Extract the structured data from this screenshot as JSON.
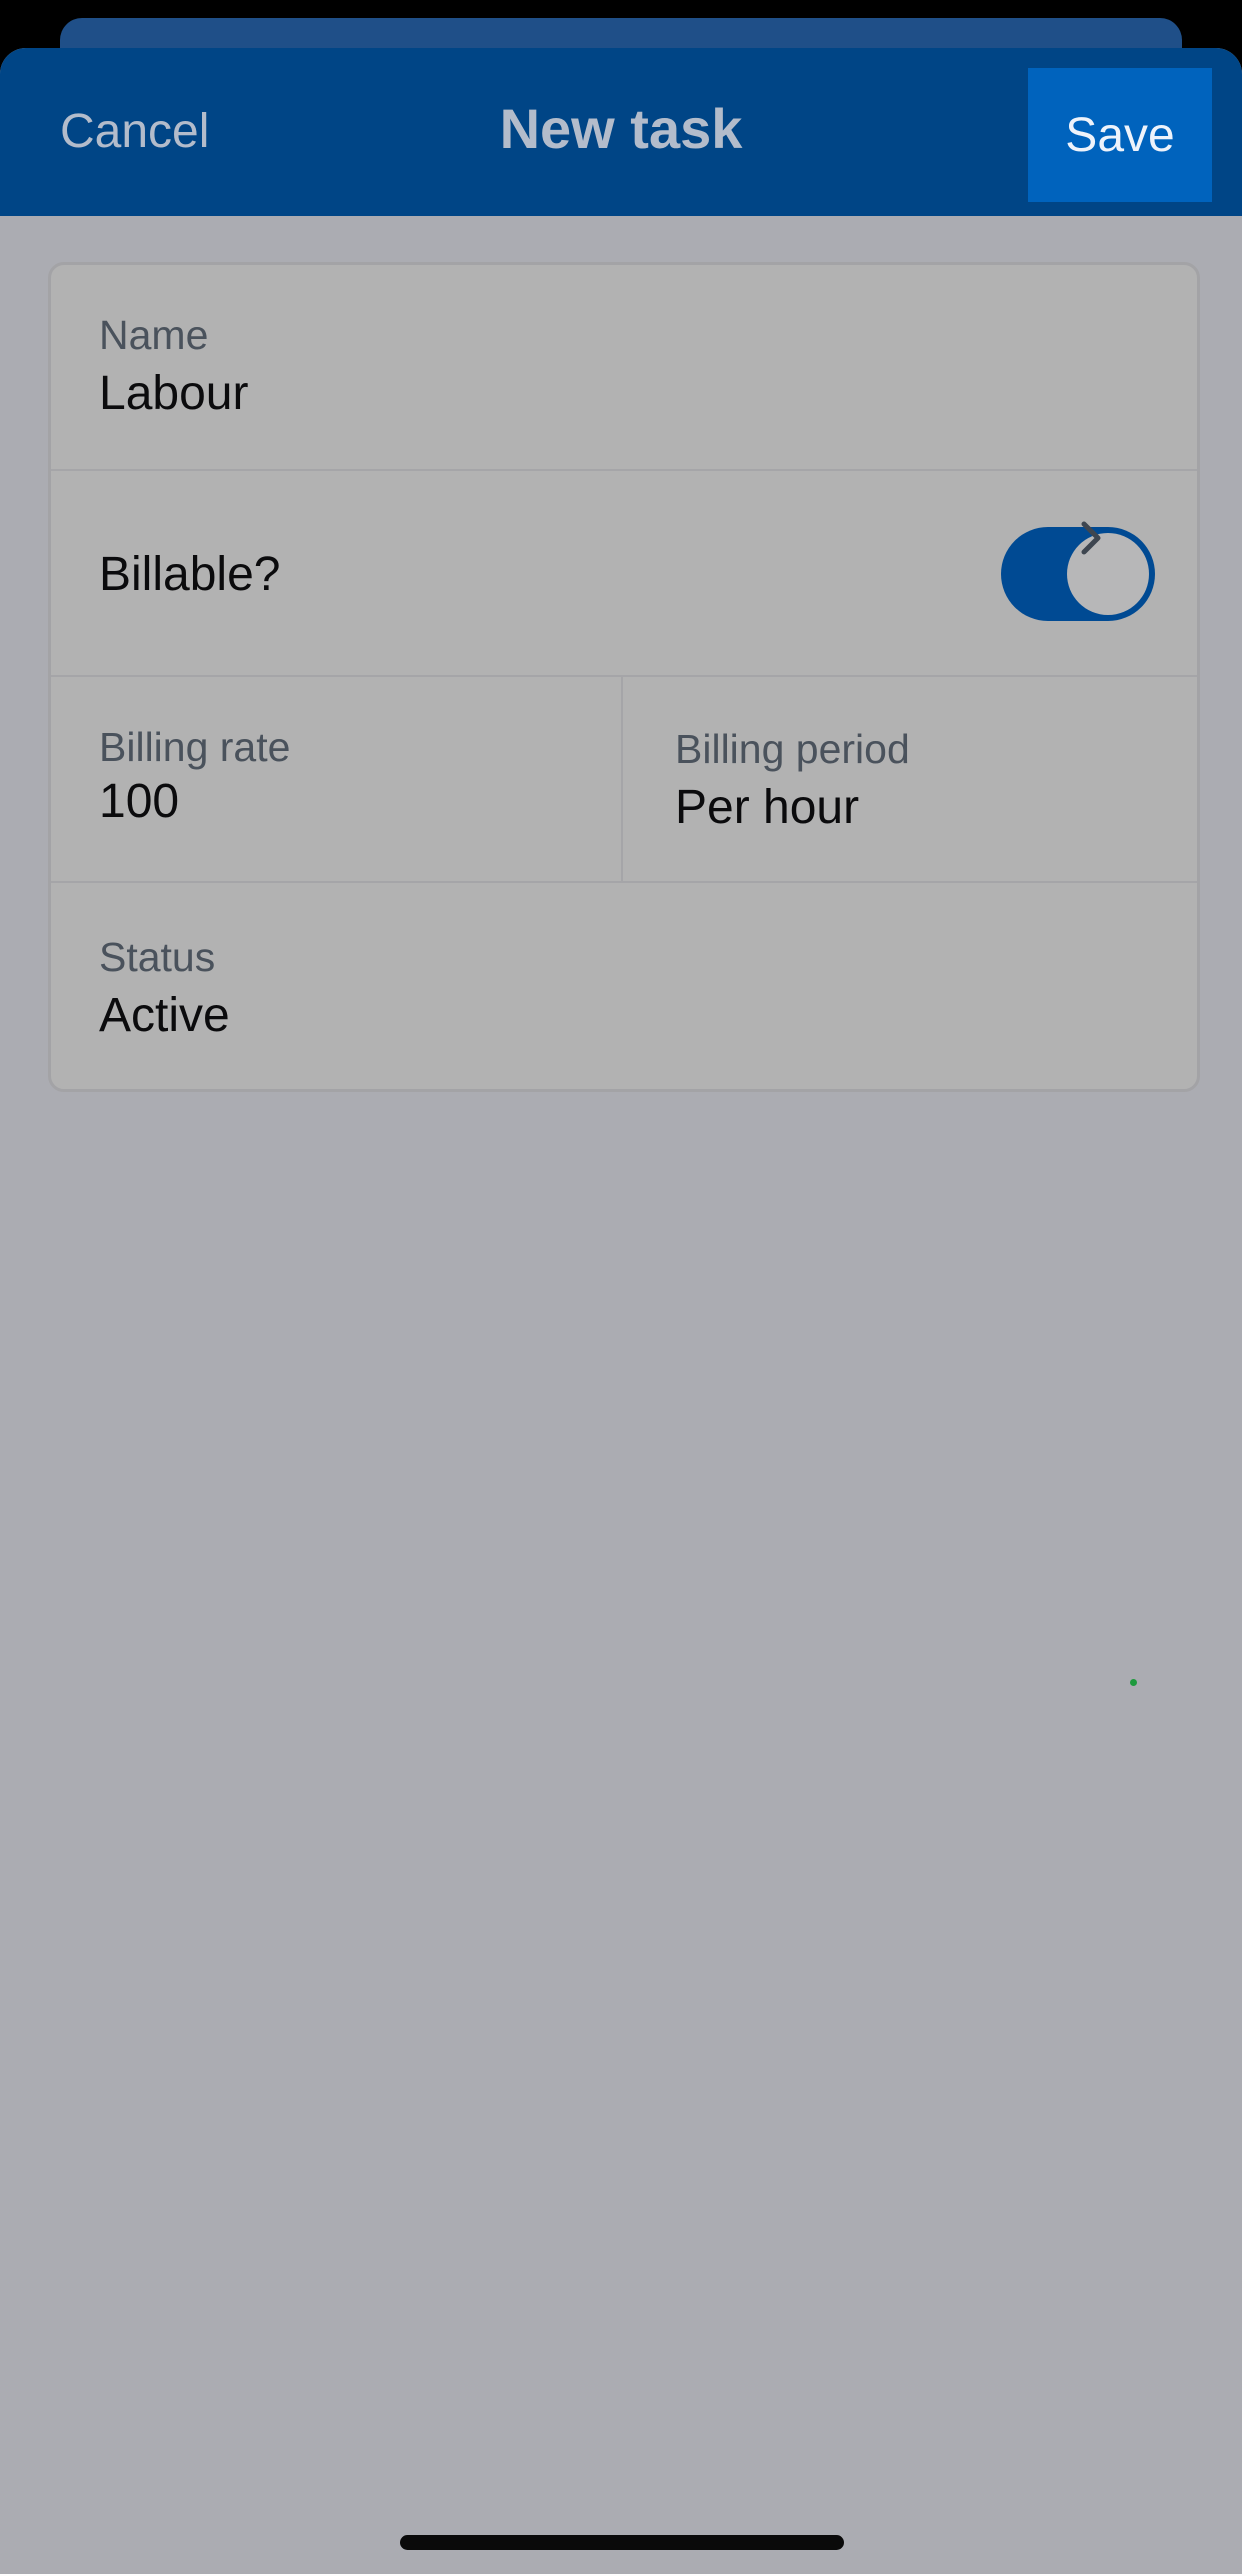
{
  "header": {
    "cancel_label": "Cancel",
    "title": "New task",
    "save_label": "Save"
  },
  "form": {
    "name": {
      "label": "Name",
      "value": "Labour"
    },
    "billable": {
      "label": "Billable?",
      "checked": true
    },
    "billing_rate": {
      "label": "Billing rate",
      "value": "100"
    },
    "billing_period": {
      "label": "Billing period",
      "value": "Per hour"
    },
    "status": {
      "label": "Status",
      "value": "Active"
    }
  },
  "icons": {
    "chevron": "chevron-right-icon"
  },
  "colors": {
    "brand": "#004586",
    "save_button": "#0063bd",
    "toggle_on": "#004a93",
    "overlay_background": "#abacb2"
  }
}
